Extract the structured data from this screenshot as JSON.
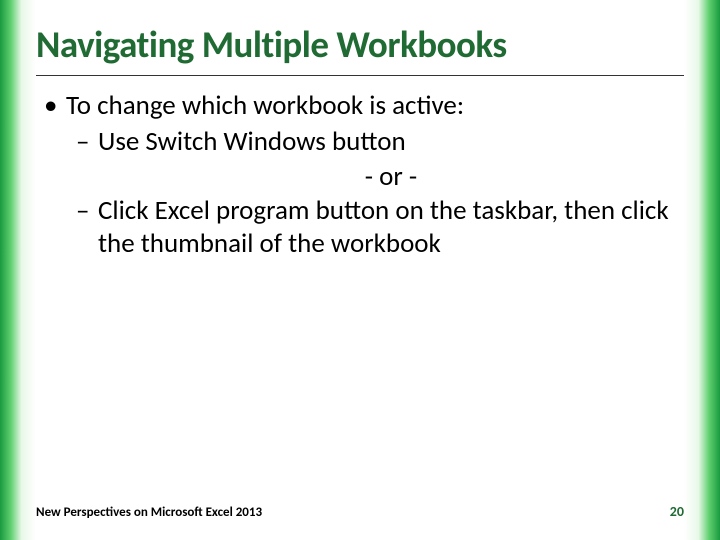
{
  "title": "Navigating Multiple Workbooks",
  "bullets": {
    "l1": "To change which workbook is active:",
    "l2a": "Use Switch Windows button",
    "or": "- or -",
    "l2b": "Click Excel program button on the taskbar, then click the thumbnail of the workbook"
  },
  "footer": {
    "text": "New Perspectives on Microsoft Excel 2013",
    "page": "20"
  }
}
